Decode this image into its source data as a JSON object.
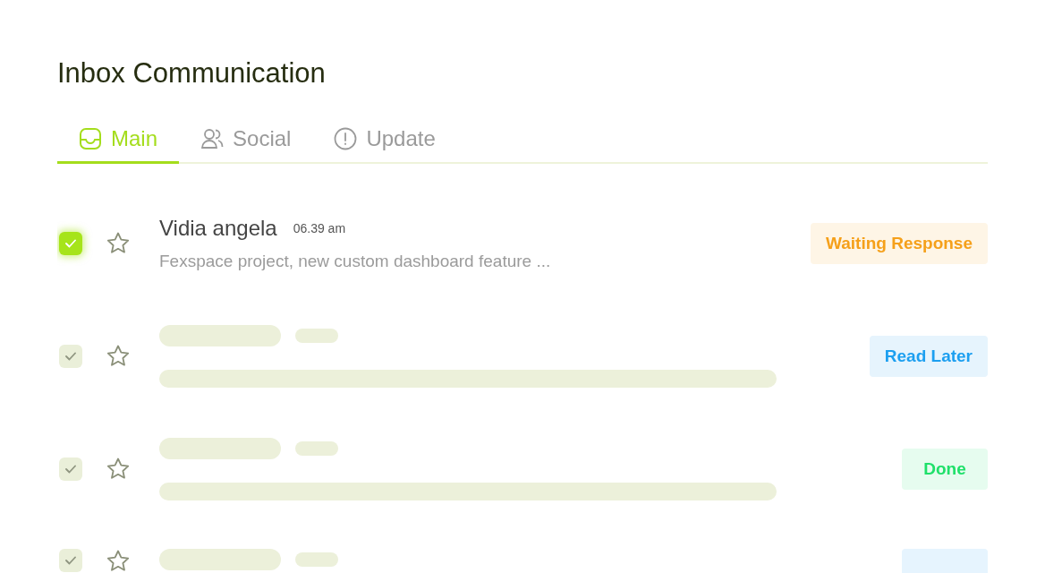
{
  "title": "Inbox Communication",
  "tabs": [
    {
      "label": "Main",
      "selected": true
    },
    {
      "label": "Social",
      "selected": false
    },
    {
      "label": "Update",
      "selected": false
    }
  ],
  "messages": [
    {
      "kind": "message",
      "selected": true,
      "checked": true,
      "sender": "Vidia angela",
      "time": "06.39 am",
      "preview": "Fexspace project, new custom dashboard feature ...",
      "tag": {
        "label": "Waiting Response",
        "color": "#f5a01a"
      }
    },
    {
      "kind": "skeleton",
      "selected": false,
      "checked": true,
      "tag": {
        "label": "Read Later",
        "color": "#1c9ff0"
      }
    },
    {
      "kind": "skeleton",
      "selected": false,
      "checked": true,
      "tag": {
        "label": "Done",
        "color": "#1fe06a"
      }
    },
    {
      "kind": "skeleton",
      "selected": false,
      "checked": true,
      "tag": {
        "color": "#e6f4fe"
      }
    }
  ]
}
